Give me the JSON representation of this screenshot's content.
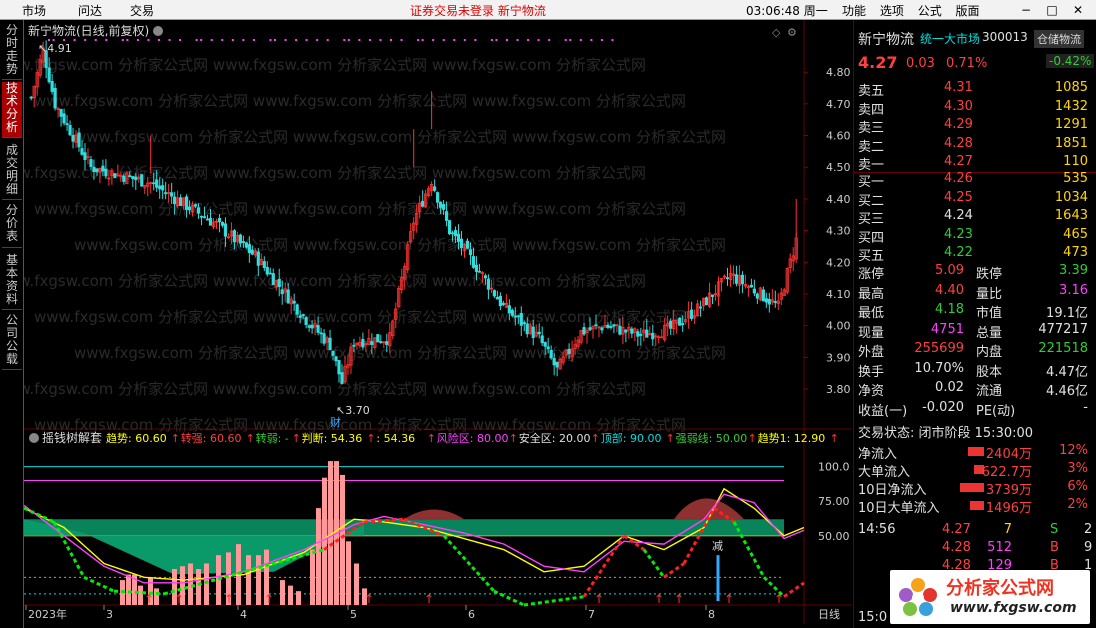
{
  "topbar": {
    "menu": [
      "市场",
      "问达",
      "交易"
    ],
    "notice": "证券交易未登录  新宁物流",
    "clock": "03:06:48 周一",
    "rmenu": [
      "功能",
      "选项",
      "公式",
      "版面"
    ],
    "win": [
      "−",
      "□",
      "✕"
    ]
  },
  "sidebar": {
    "tabs": [
      "分时走势",
      "技术分析",
      "成交明细",
      "分价表",
      "基本资料",
      "公司公载"
    ]
  },
  "chart": {
    "title": "新宁物流(日线,前复权)",
    "yticks": [
      "4.80",
      "4.70",
      "4.60",
      "4.50",
      "4.40",
      "4.30",
      "4.20",
      "4.10",
      "4.00",
      "3.90",
      "3.80"
    ],
    "high_label": "4.91",
    "low_label": "3.70",
    "low_tag": "财",
    "watermark": "www.fxgsw.com 分析家公式网",
    "indicator_title": "摇钱树解套",
    "ind_items": [
      {
        "t": "趋势: 60.60",
        "c": "#ffff00"
      },
      {
        "t": "转强: 60.60",
        "c": "#ff4040"
      },
      {
        "t": "转弱: -",
        "c": "#33cc33"
      },
      {
        "t": "判断: 54.36",
        "c": "#ffff00"
      },
      {
        "t": ": 54.36",
        "c": "#ffff00"
      },
      {
        "t": "风险区: 80.00",
        "c": "#ff40ff"
      },
      {
        "t": "安全区: 20.00",
        "c": "#e0e0e0"
      },
      {
        "t": "顶部: 90.00",
        "c": "#00dddd"
      },
      {
        "t": "强弱线: 50.00",
        "c": "#33cc33"
      },
      {
        "t": "趋势1: 12.90",
        "c": "#ffff00"
      }
    ],
    "ind_yticks": [
      "100.0",
      "75.00",
      "50.00"
    ],
    "ind_tag": "减",
    "xlabels": [
      "2023年",
      "3",
      "4",
      "5",
      "6",
      "7",
      "8"
    ],
    "period": "日线"
  },
  "quote": {
    "name": "新宁物流",
    "board": "统一大市场",
    "code": "300013",
    "tag": "仓储物流",
    "tag_change": "-0.42%",
    "price": "4.27",
    "chg": "0.03",
    "pct": "0.71%",
    "asks": [
      [
        "卖五",
        "4.31",
        "1085"
      ],
      [
        "卖四",
        "4.30",
        "1432"
      ],
      [
        "卖三",
        "4.29",
        "1291"
      ],
      [
        "卖二",
        "4.28",
        "1851"
      ],
      [
        "卖一",
        "4.27",
        "110"
      ]
    ],
    "bids": [
      [
        "买一",
        "4.26",
        "535"
      ],
      [
        "买二",
        "4.25",
        "1034"
      ],
      [
        "买三",
        "4.24",
        "1643"
      ],
      [
        "买四",
        "4.23",
        "465"
      ],
      [
        "买五",
        "4.22",
        "473"
      ]
    ],
    "stats": [
      [
        "涨停",
        "5.09",
        "跌停",
        "3.39"
      ],
      [
        "最高",
        "4.40",
        "量比",
        "3.16"
      ],
      [
        "最低",
        "4.18",
        "市值",
        "19.1亿"
      ],
      [
        "现量",
        "4751",
        "总量",
        "477217"
      ],
      [
        "外盘",
        "255699",
        "内盘",
        "221518"
      ],
      [
        "换手",
        "10.70%",
        "股本",
        "4.47亿"
      ],
      [
        "净资",
        "0.02",
        "流通",
        "4.46亿"
      ],
      [
        "收益(一)",
        "-0.020",
        "PE(动)",
        "-"
      ]
    ],
    "status": "交易状态: 闭市阶段 15:30:00",
    "flows": [
      [
        "净流入",
        "2404万",
        "12%"
      ],
      [
        "大单流入",
        "622.7万",
        "3%"
      ],
      [
        "10日净流入",
        "3739万",
        "6%"
      ],
      [
        "10日大单流入",
        "1496万",
        "2%"
      ]
    ],
    "ticks": [
      [
        "14:56",
        "4.27",
        "7",
        "S",
        "2"
      ],
      [
        "",
        "4.28",
        "512",
        "B",
        "9"
      ],
      [
        "",
        "4.28",
        "129",
        "B",
        "1"
      ]
    ],
    "tail": "15:0",
    "logo_text": "分析家公式网",
    "logo_url": "www.fxgsw.com"
  },
  "colors": {
    "up": "#ff3333",
    "down": "#33dddd",
    "bg": "#000000"
  }
}
